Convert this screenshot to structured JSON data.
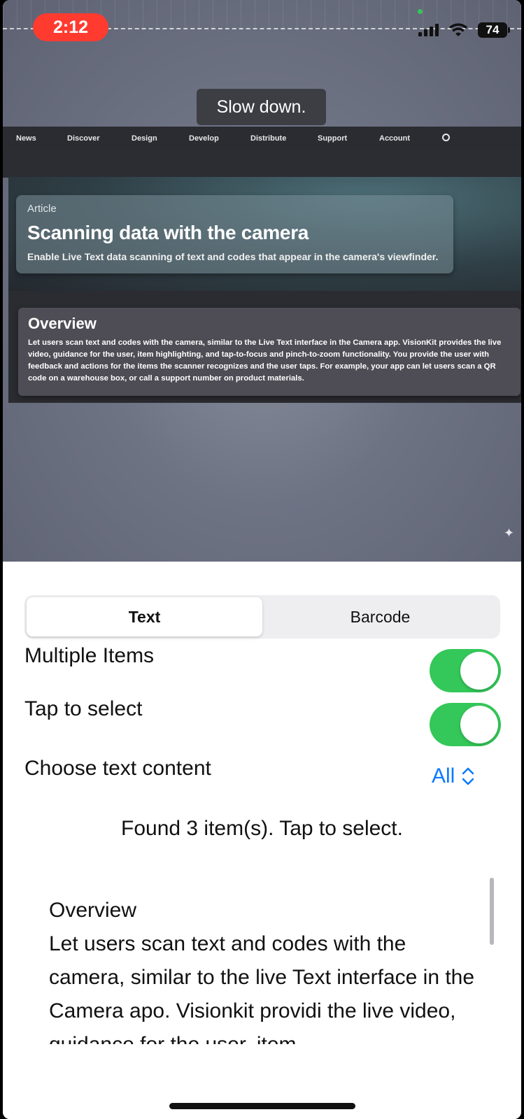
{
  "status_bar": {
    "time": "2:12",
    "battery": "74"
  },
  "camera": {
    "hint": "Slow down.",
    "site_nav": [
      "News",
      "Discover",
      "Design",
      "Develop",
      "Distribute",
      "Support",
      "Account"
    ],
    "article": {
      "kicker": "Article",
      "title": "Scanning data with the camera",
      "subtitle": "Enable Live Text data scanning of text and codes that appear in the camera's viewfinder."
    },
    "overview": {
      "title": "Overview",
      "body": "Let users scan text and codes with the camera, similar to the Live Text interface in the Camera app. VisionKit provides the live video, guidance for the user, item highlighting, and tap-to-focus and pinch-to-zoom functionality. You provide the user with feedback and actions for the items the scanner recognizes and the user taps. For example, your app can let users scan a QR code on a warehouse box, or call a support number on product materials."
    }
  },
  "controls": {
    "segments": [
      "Text",
      "Barcode"
    ],
    "selected_segment": "Text",
    "multiple_items": {
      "label": "Multiple Items",
      "on": true
    },
    "tap_to_select": {
      "label": "Tap to select",
      "on": true
    },
    "text_content": {
      "label": "Choose text content",
      "value": "All"
    },
    "found_message": "Found 3 item(s). Tap to select.",
    "recognized_text": "Overview\nLet users scan text and codes with the camera, similar to the live Text interface in the Camera apo. Visionkit providi the live video, guidance for the user, item"
  },
  "colors": {
    "toggle_on": "#34c759",
    "accent": "#0a7aff",
    "recording": "#ff3b30"
  }
}
